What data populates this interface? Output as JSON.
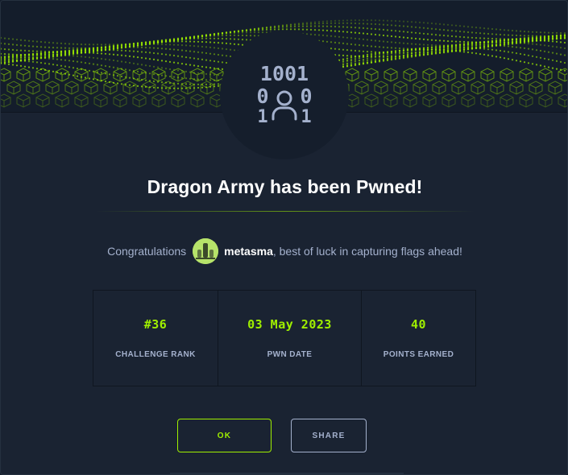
{
  "modal": {
    "title": "Dragon Army has been Pwned!",
    "avatar_icon": "binary-user-icon",
    "avatar_digits_top": "1001",
    "avatar_digits_left": "0",
    "avatar_digits_right": "0",
    "avatar_digits_bottom_left": "1",
    "avatar_digits_bottom_right": "1"
  },
  "congrats": {
    "prefix": "Congratulations",
    "username": "metasma",
    "suffix": ", best of luck in capturing flags ahead!"
  },
  "stats": [
    {
      "value": "#36",
      "label": "CHALLENGE RANK"
    },
    {
      "value": "03 May 2023",
      "label": "PWN DATE"
    },
    {
      "value": "40",
      "label": "POINTS EARNED"
    }
  ],
  "buttons": {
    "ok": "OK",
    "share": "SHARE"
  },
  "colors": {
    "accent": "#9fef00",
    "background": "#1a2332",
    "text_muted": "#a4b1cd"
  }
}
